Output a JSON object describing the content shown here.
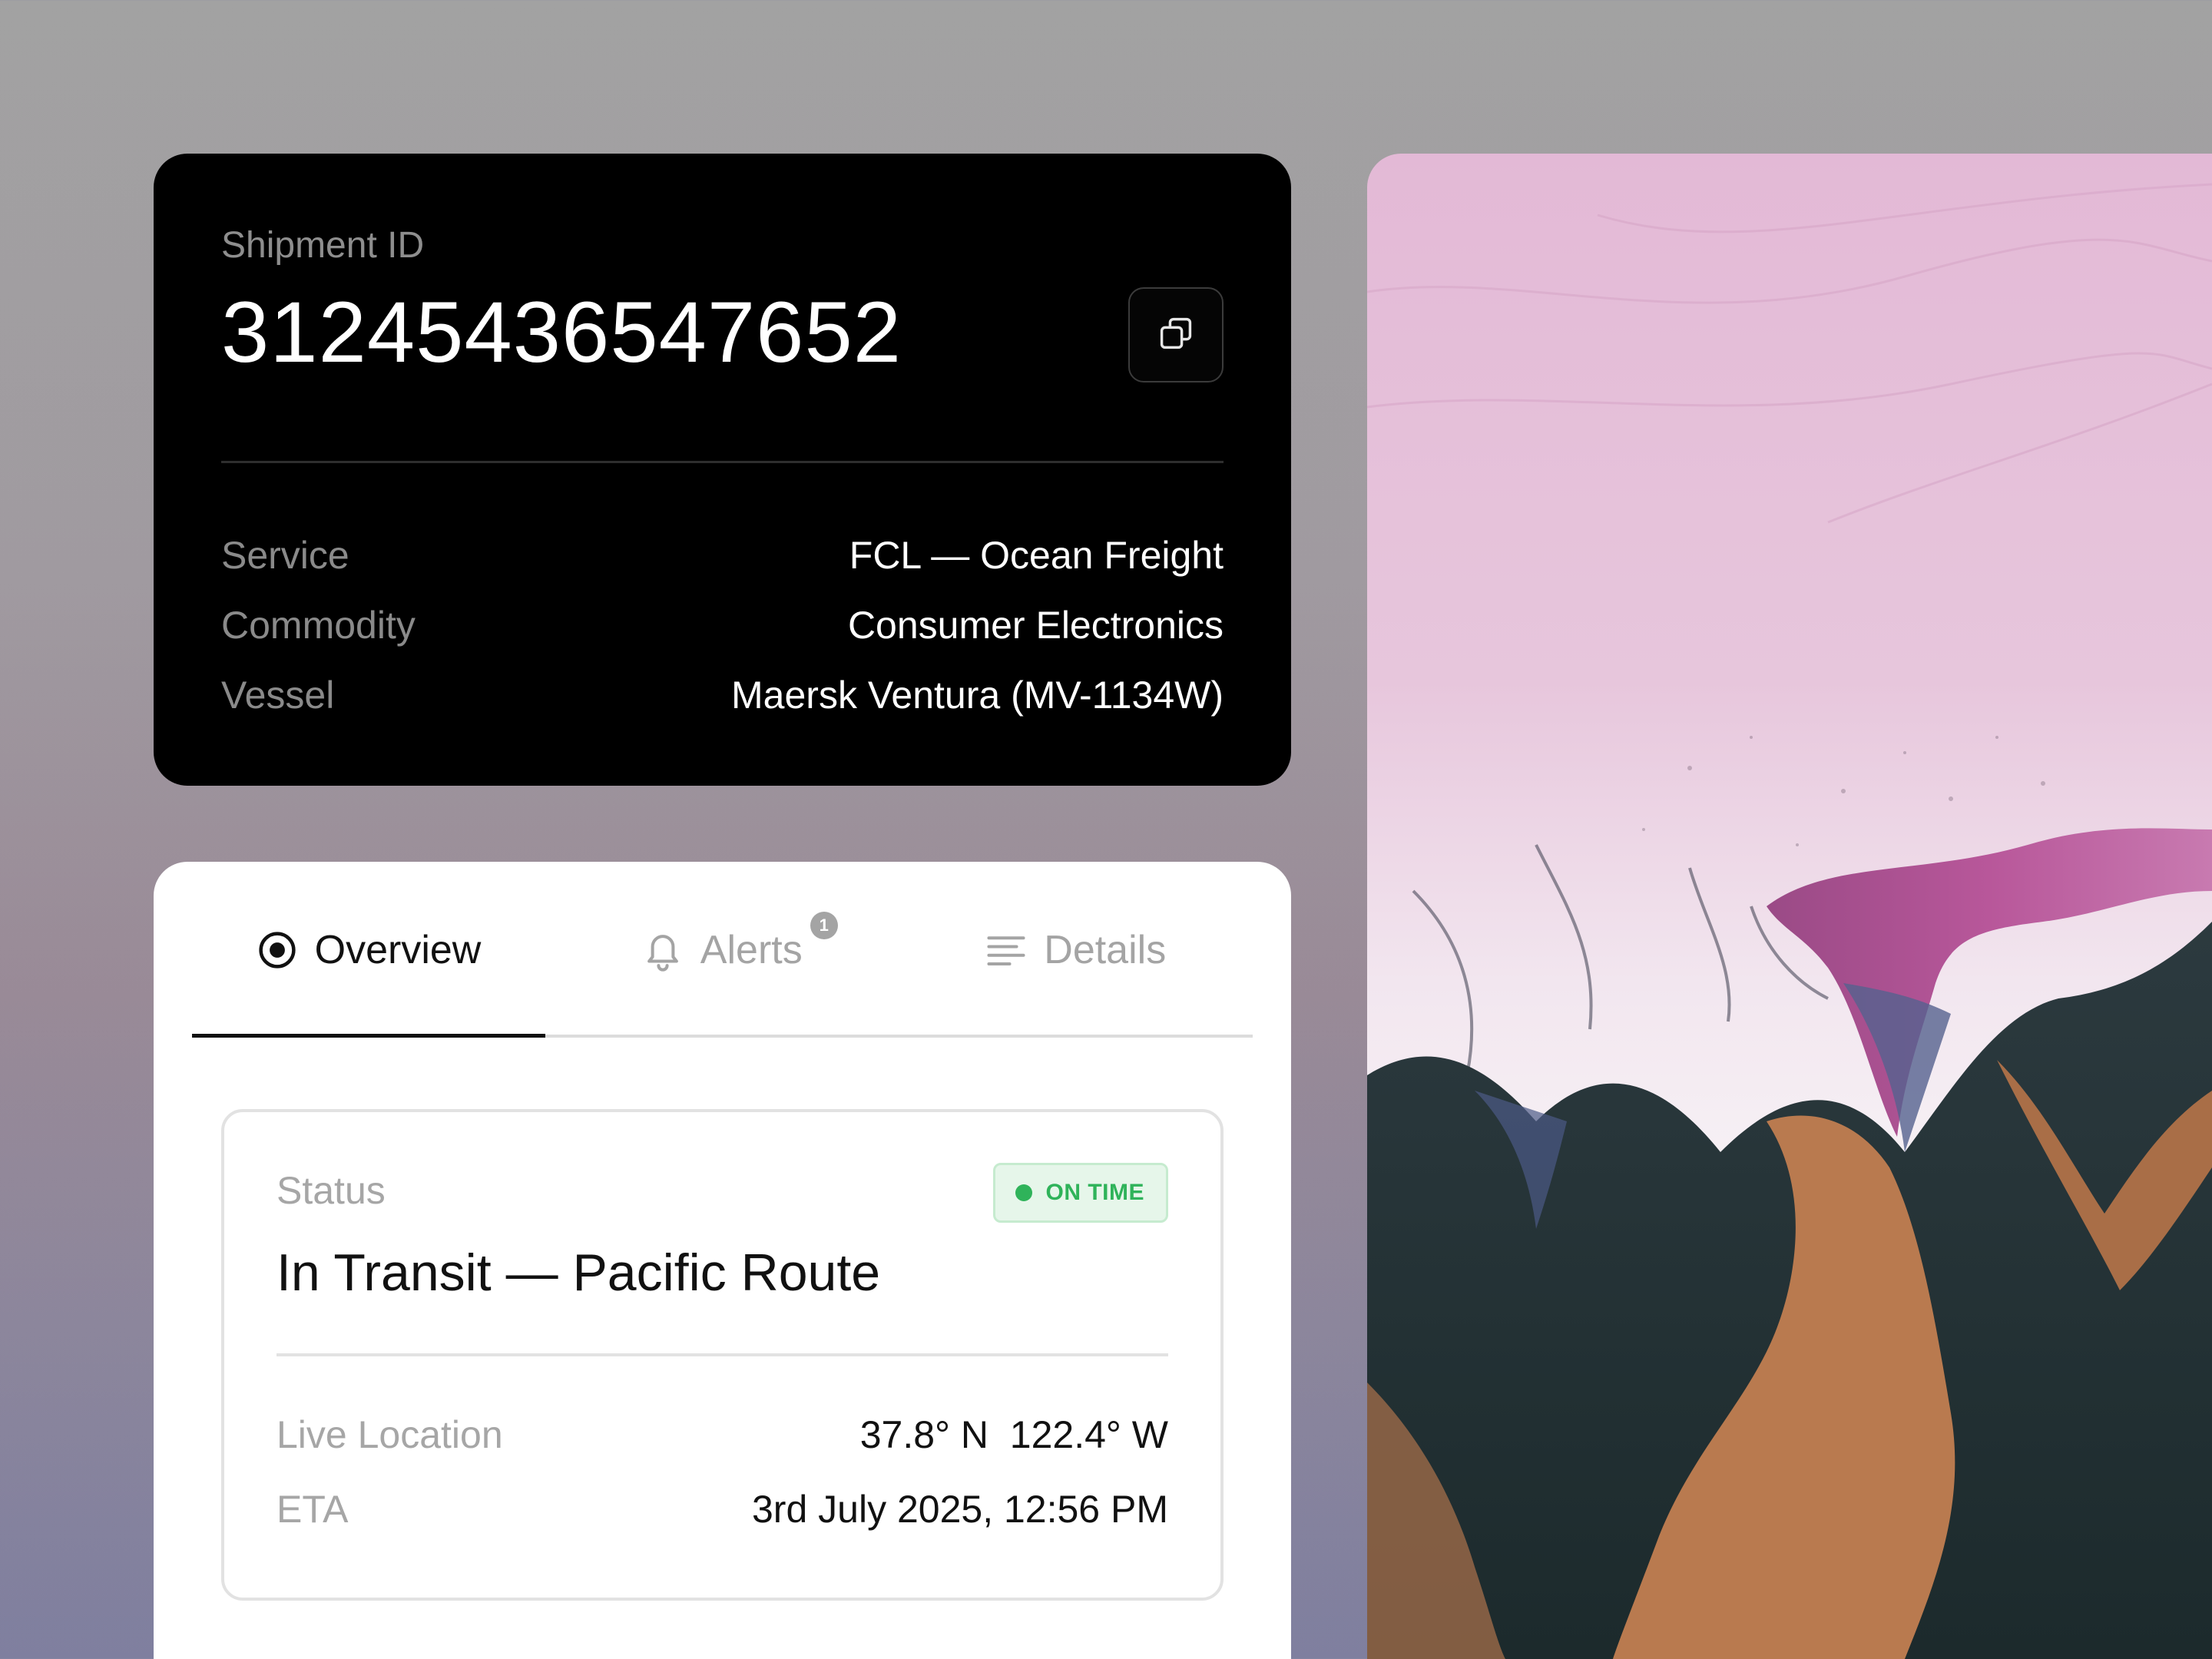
{
  "shipment": {
    "id_label": "Shipment ID",
    "id_value": "31245436547652",
    "copy_icon": "copy-icon",
    "details": [
      {
        "key": "Service",
        "value": "FCL — Ocean Freight"
      },
      {
        "key": "Commodity",
        "value": "Consumer Electronics"
      },
      {
        "key": "Vessel",
        "value": "Maersk Ventura (MV-1134W)"
      }
    ]
  },
  "tabs": [
    {
      "label": "Overview",
      "icon": "target-icon",
      "active": true
    },
    {
      "label": "Alerts",
      "icon": "bell-icon",
      "badge": "1"
    },
    {
      "label": "Details",
      "icon": "lines-icon"
    }
  ],
  "status": {
    "label": "Status",
    "badge": "ON TIME",
    "badge_color": "#2fb35a",
    "title": "In Transit — Pacific Route",
    "rows": [
      {
        "key": "Live Location",
        "value": "37.8° N  122.4° W"
      },
      {
        "key": "ETA",
        "value": "3rd July 2025, 12:56 PM"
      }
    ]
  },
  "colors": {
    "card_dark": "#000000",
    "card_light": "#ffffff",
    "accent_green": "#2fb35a"
  }
}
